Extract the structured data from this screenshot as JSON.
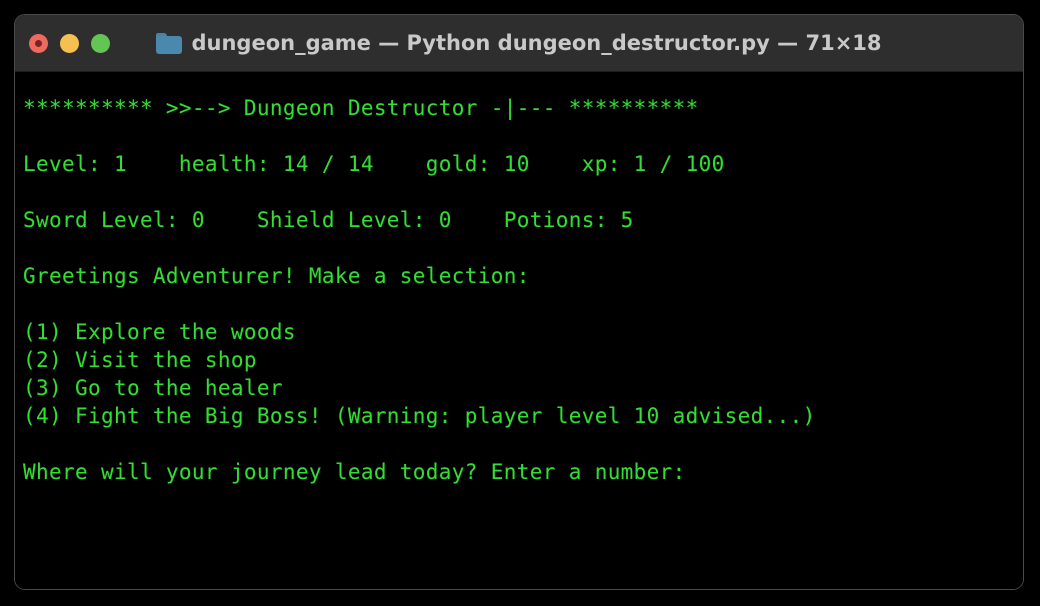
{
  "window": {
    "title": "dungeon_game — Python dungeon_destructor.py — 71×18",
    "folder_name": "dungeon_game",
    "program": "Python dungeon_destructor.py",
    "size": "71×18",
    "icons": {
      "folder": "folder-icon",
      "close": "close-traffic-light",
      "minimize": "minimize-traffic-light",
      "maximize": "maximize-traffic-light"
    },
    "colors": {
      "titlebar_bg": "#2e2e2e",
      "title_text": "#c9c9c9",
      "terminal_bg": "#000000",
      "terminal_text": "#33dd33",
      "close": "#ed6a5e",
      "minimize": "#f5c04f",
      "maximize": "#62c554",
      "folder": "#4b88ae"
    }
  },
  "terminal": {
    "banner": "********** >>--> Dungeon Destructor -|--- **********",
    "stats_line": "Level: 1    health: 14 / 14    gold: 10    xp: 1 / 100",
    "gear_line": "Sword Level: 0    Shield Level: 0    Potions: 5",
    "greeting": "Greetings Adventurer! Make a selection:",
    "menu": [
      "(1) Explore the woods",
      "(2) Visit the shop",
      "(3) Go to the healer",
      "(4) Fight the Big Boss! (Warning: player level 10 advised...)"
    ],
    "prompt": "Where will your journey lead today? Enter a number:",
    "blank": " ",
    "stats": {
      "level": 1,
      "health_current": 14,
      "health_max": 14,
      "gold": 10,
      "xp_current": 1,
      "xp_max": 100,
      "sword_level": 0,
      "shield_level": 0,
      "potions": 5
    }
  }
}
